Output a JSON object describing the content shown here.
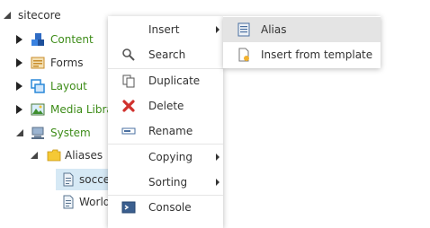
{
  "tree": {
    "root": "sitecore",
    "items": {
      "content": "Content",
      "forms": "Forms",
      "layout": "Layout",
      "media": "Media Library",
      "system": "System",
      "aliases": "Aliases",
      "soccer": "soccer",
      "world": "World"
    },
    "colors": {
      "green_label": "#3d8c18",
      "selected_bg": "#d6e9f5"
    }
  },
  "context_menu": {
    "insert": "Insert",
    "search": "Search",
    "duplicate": "Duplicate",
    "delete": "Delete",
    "rename": "Rename",
    "copying": "Copying",
    "sorting": "Sorting",
    "console": "Console"
  },
  "insert_submenu": {
    "alias": "Alias",
    "insert_from_template": "Insert from template"
  }
}
